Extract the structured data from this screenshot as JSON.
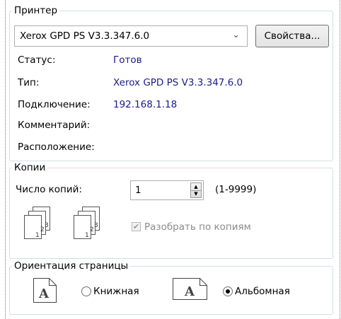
{
  "printer": {
    "group_label": "Принтер",
    "selected_printer": "Xerox GPD PS V3.3.347.6.0",
    "properties_button": "Свойства...",
    "rows": [
      {
        "label": "Статус:",
        "value": "Готов"
      },
      {
        "label": "Тип:",
        "value": "Xerox GPD PS V3.3.347.6.0"
      },
      {
        "label": "Подключение:",
        "value": "192.168.1.18"
      },
      {
        "label": "Комментарий:",
        "value": ""
      },
      {
        "label": "Расположение:",
        "value": ""
      }
    ]
  },
  "copies": {
    "group_label": "Копии",
    "count_label": "Число копий:",
    "count_value": "1",
    "range_hint": "(1-9999)",
    "collate_label": "Разобрать по копиям",
    "collate_checked": true,
    "collate_enabled": false,
    "page_numbers": [
      "1",
      "2",
      "3"
    ]
  },
  "orientation": {
    "group_label": "Ориентация страницы",
    "portrait_label": "Книжная",
    "landscape_label": "Альбомная",
    "selected": "landscape",
    "icon_letter": "A"
  }
}
